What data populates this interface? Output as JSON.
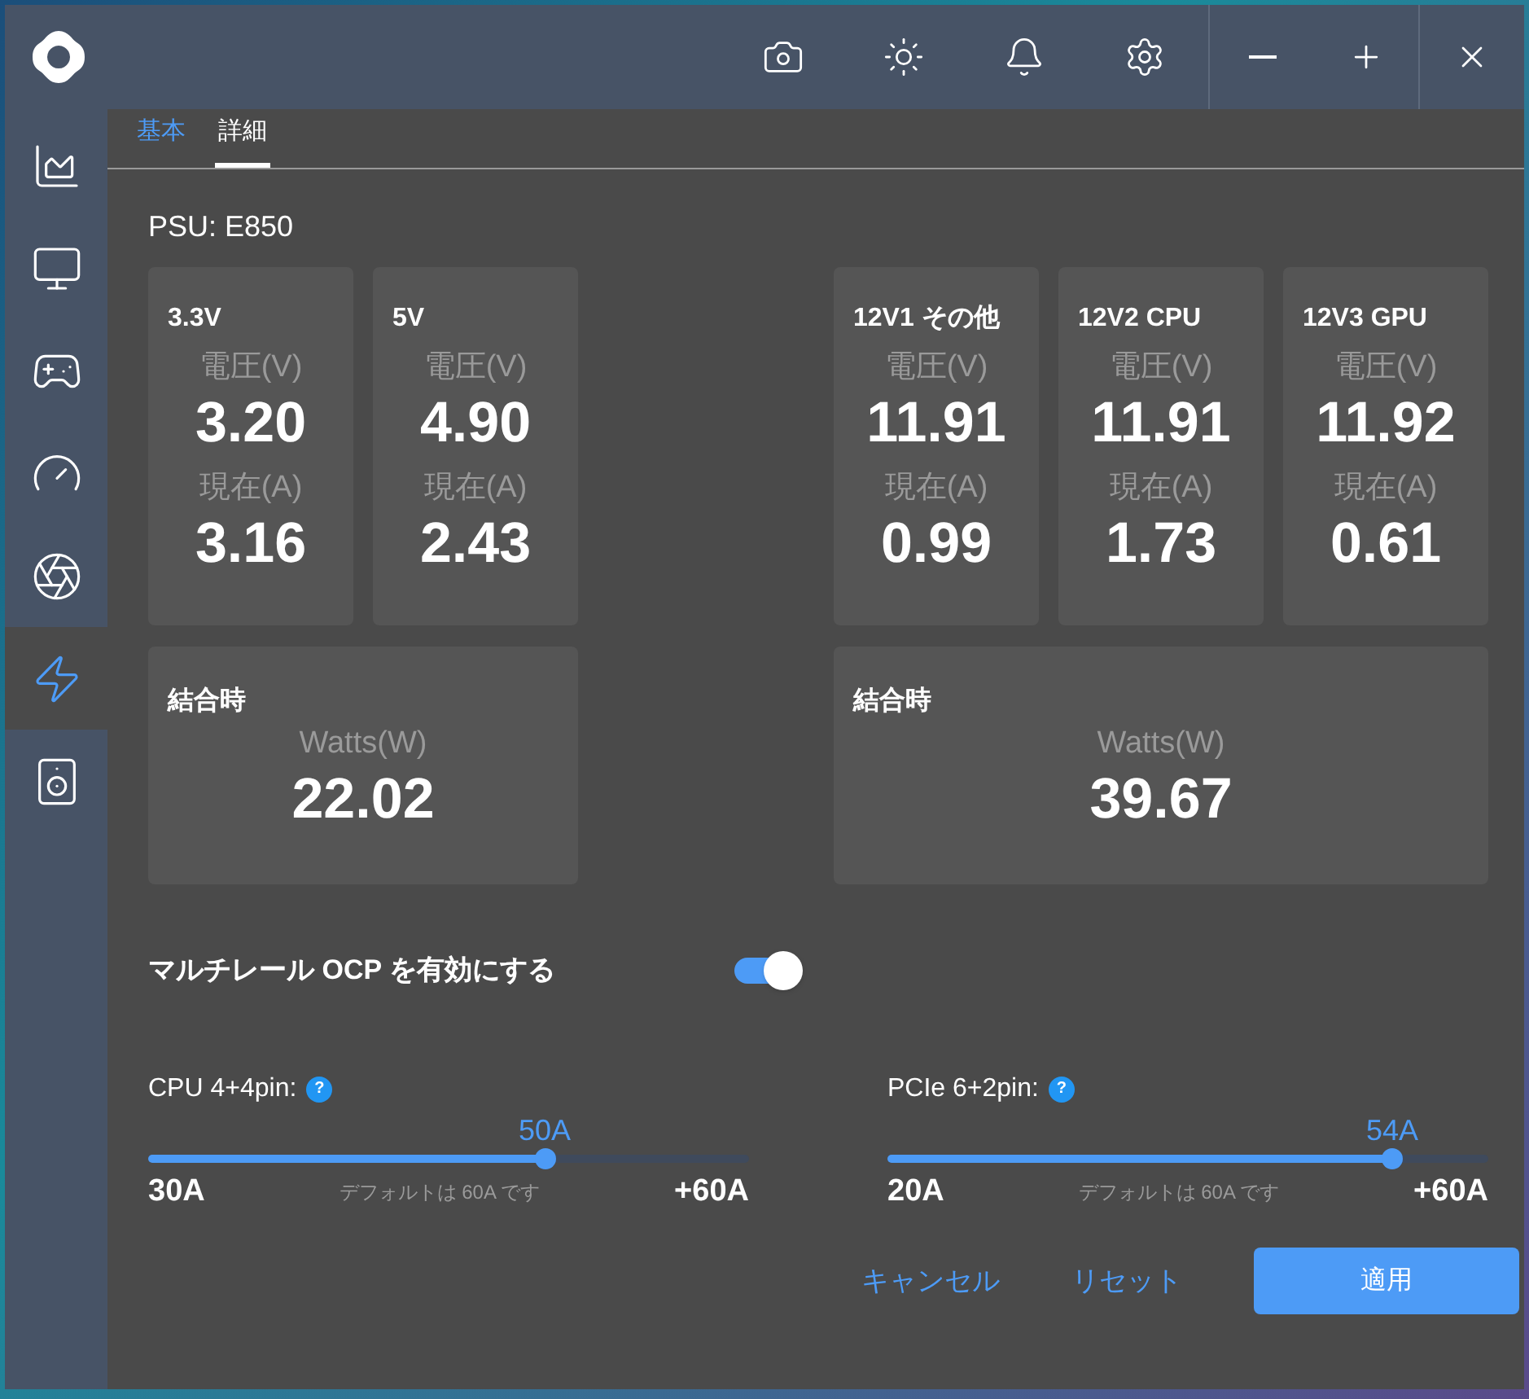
{
  "sidebar": {
    "items": [
      {
        "selected": false
      },
      {
        "selected": false
      },
      {
        "selected": false
      },
      {
        "selected": false
      },
      {
        "selected": false
      },
      {
        "selected": true
      },
      {
        "selected": false
      }
    ]
  },
  "tabs": [
    {
      "label": "基本",
      "selected": false
    },
    {
      "label": "詳細",
      "selected": true
    }
  ],
  "psu_label": "PSU: E850",
  "rail_groups": [
    {
      "rails": [
        {
          "name": "3.3V",
          "voltage_label": "電圧(V)",
          "voltage": "3.20",
          "current_label": "現在(A)",
          "current": "3.16"
        },
        {
          "name": "5V",
          "voltage_label": "電圧(V)",
          "voltage": "4.90",
          "current_label": "現在(A)",
          "current": "2.43"
        }
      ],
      "combined": {
        "title": "結合時",
        "watts_label": "Watts(W)",
        "watts": "22.02"
      }
    },
    {
      "rails": [
        {
          "name": "12V1 その他",
          "voltage_label": "電圧(V)",
          "voltage": "11.91",
          "current_label": "現在(A)",
          "current": "0.99"
        },
        {
          "name": "12V2 CPU",
          "voltage_label": "電圧(V)",
          "voltage": "11.91",
          "current_label": "現在(A)",
          "current": "1.73"
        },
        {
          "name": "12V3 GPU",
          "voltage_label": "電圧(V)",
          "voltage": "11.92",
          "current_label": "現在(A)",
          "current": "0.61"
        }
      ],
      "combined": {
        "title": "結合時",
        "watts_label": "Watts(W)",
        "watts": "39.67"
      }
    }
  ],
  "toggle": {
    "label": "マルチレール OCP を有効にする",
    "on": true
  },
  "sliders": [
    {
      "label": "CPU 4+4pin:",
      "help": "?",
      "value": "50A",
      "level": 0.66,
      "min": "30A",
      "note": "デフォルトは 60A です",
      "max": "+60A"
    },
    {
      "label": "PCIe 6+2pin:",
      "help": "?",
      "value": "54A",
      "level": 0.84,
      "min": "20A",
      "note": "デフォルトは 60A です",
      "max": "+60A"
    }
  ],
  "buttons": [
    {
      "label": "キャンセル",
      "kind": "link"
    },
    {
      "label": "リセット",
      "kind": "link"
    },
    {
      "label": "適用",
      "kind": "primary"
    }
  ]
}
